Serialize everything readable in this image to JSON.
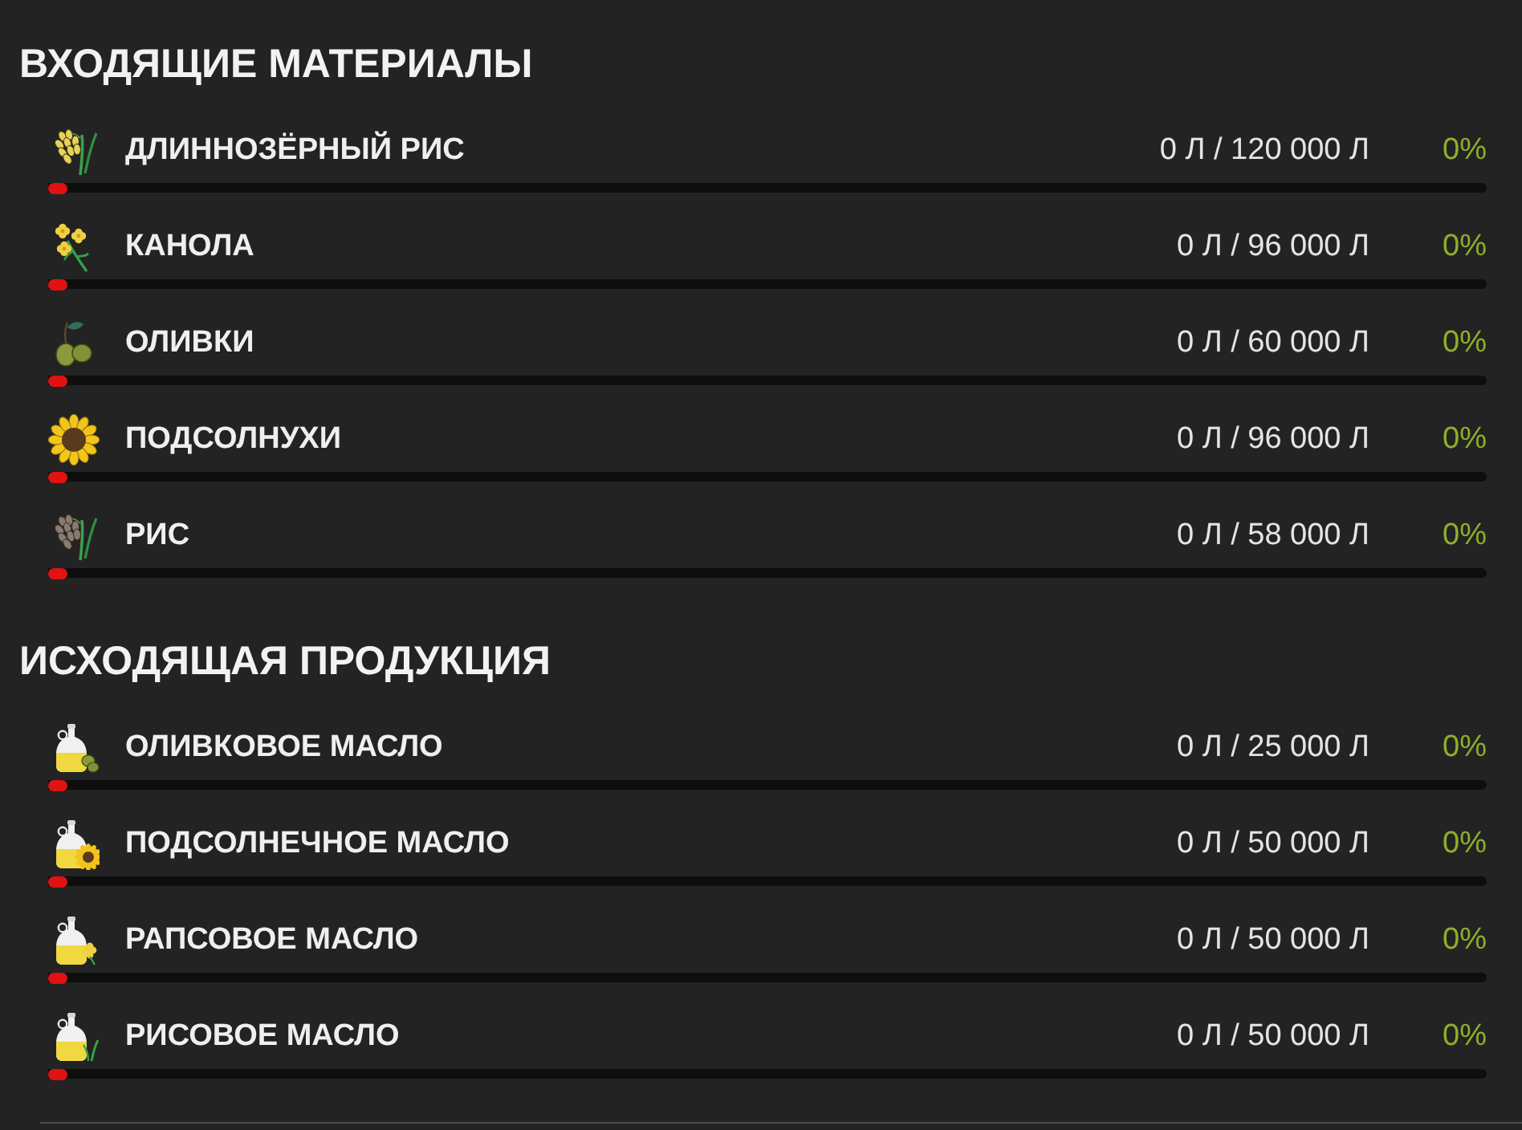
{
  "sections": [
    {
      "title": "ВХОДЯЩИЕ МАТЕРИАЛЫ",
      "items": [
        {
          "kind": "long_grain_rice",
          "name": "ДЛИННОЗЁРНЫЙ РИС",
          "amount": "0 Л / 120 000 Л",
          "percent": "0%",
          "level": 0
        },
        {
          "kind": "canola",
          "name": "КАНОЛА",
          "amount": "0 Л / 96 000 Л",
          "percent": "0%",
          "level": 0
        },
        {
          "kind": "olives",
          "name": "ОЛИВКИ",
          "amount": "0 Л / 60 000 Л",
          "percent": "0%",
          "level": 0
        },
        {
          "kind": "sunflower",
          "name": "ПОДСОЛНУХИ",
          "amount": "0 Л / 96 000 Л",
          "percent": "0%",
          "level": 0
        },
        {
          "kind": "rice",
          "name": "РИС",
          "amount": "0 Л / 58 000 Л",
          "percent": "0%",
          "level": 0
        }
      ]
    },
    {
      "title": "ИСХОДЯЩАЯ ПРОДУКЦИЯ",
      "items": [
        {
          "kind": "olive_oil",
          "name": "ОЛИВКОВОЕ МАСЛО",
          "amount": "0 Л / 25 000 Л",
          "percent": "0%",
          "level": 0
        },
        {
          "kind": "sunflower_oil",
          "name": "ПОДСОЛНЕЧНОЕ МАСЛО",
          "amount": "0 Л / 50 000 Л",
          "percent": "0%",
          "level": 0
        },
        {
          "kind": "canola_oil",
          "name": "РАПСОВОЕ МАСЛО",
          "amount": "0 Л / 50 000 Л",
          "percent": "0%",
          "level": 0
        },
        {
          "kind": "rice_oil",
          "name": "РИСОВОЕ МАСЛО",
          "amount": "0 Л / 50 000 Л",
          "percent": "0%",
          "level": 0
        }
      ]
    }
  ]
}
